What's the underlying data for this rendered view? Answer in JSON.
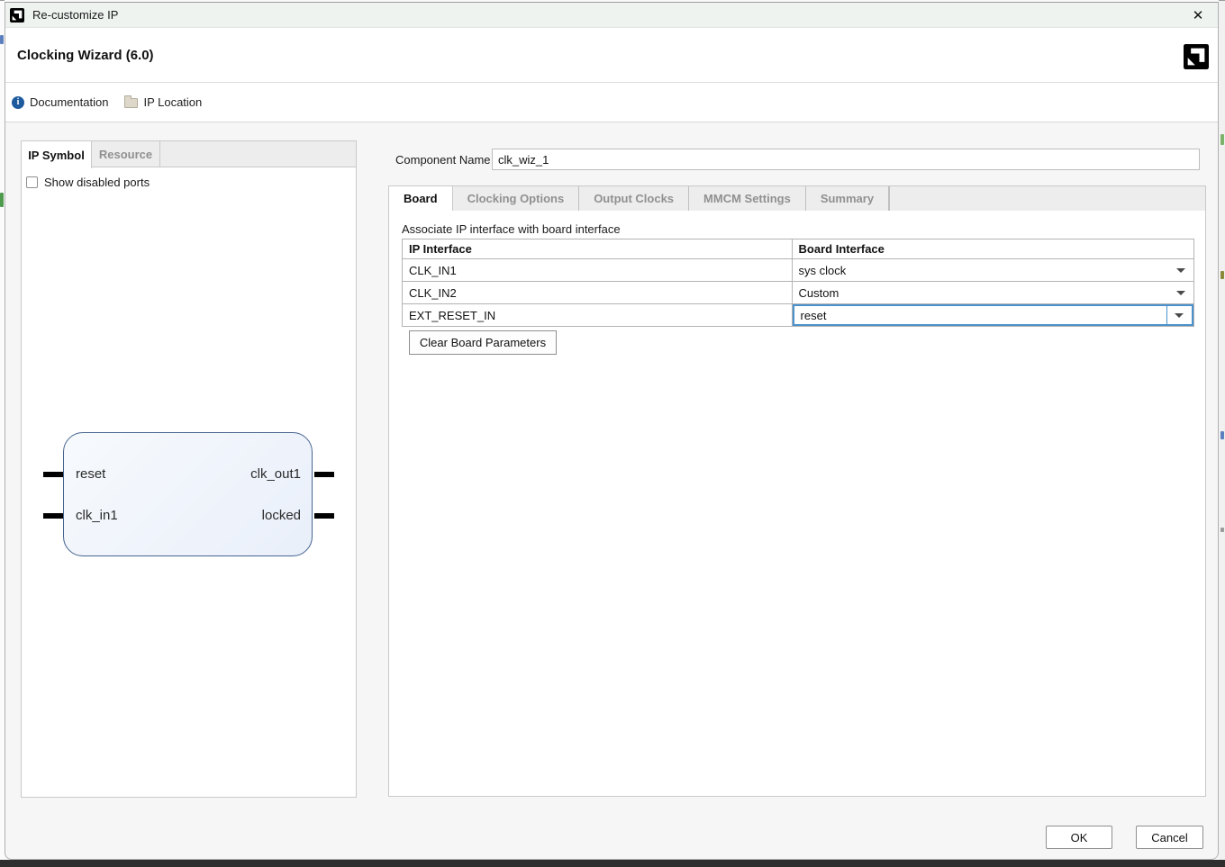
{
  "window": {
    "title": "Re-customize IP",
    "close_glyph": "✕"
  },
  "header": {
    "title": "Clocking Wizard (6.0)"
  },
  "toolbar": {
    "documentation_label": "Documentation",
    "ip_location_label": "IP Location"
  },
  "left_panel": {
    "tabs": [
      {
        "label": "IP Symbol",
        "active": true
      },
      {
        "label": "Resource",
        "active": false
      }
    ],
    "show_disabled_ports_label": "Show disabled ports",
    "ip_symbol": {
      "left_ports": [
        "reset",
        "clk_in1"
      ],
      "right_ports": [
        "clk_out1",
        "locked"
      ]
    }
  },
  "right_panel": {
    "component_name_label": "Component Name",
    "component_name_value": "clk_wiz_1",
    "tabs": [
      {
        "label": "Board",
        "active": true
      },
      {
        "label": "Clocking Options",
        "active": false
      },
      {
        "label": "Output Clocks",
        "active": false
      },
      {
        "label": "MMCM Settings",
        "active": false
      },
      {
        "label": "Summary",
        "active": false
      }
    ],
    "board_tab": {
      "caption": "Associate IP interface with board interface",
      "table": {
        "headers": [
          "IP Interface",
          "Board Interface"
        ],
        "rows": [
          {
            "ip_interface": "CLK_IN1",
            "board_interface": "sys clock",
            "selected": false
          },
          {
            "ip_interface": "CLK_IN2",
            "board_interface": "Custom",
            "selected": false
          },
          {
            "ip_interface": "EXT_RESET_IN",
            "board_interface": "reset",
            "selected": true
          }
        ]
      },
      "clear_button_label": "Clear Board Parameters"
    }
  },
  "footer": {
    "ok_label": "OK",
    "cancel_label": "Cancel"
  },
  "icons": {
    "app_icon": "xilinx-logo",
    "brand_logo": "xilinx-logo",
    "info": "info-circle",
    "folder": "folder"
  },
  "colors": {
    "titlebar_bg": "#eef3f0",
    "dialog_bg": "#f6f6f6",
    "selection_blue": "#4b92cc",
    "ip_block_border": "#47648f",
    "inactive_tab_text": "#909090"
  }
}
